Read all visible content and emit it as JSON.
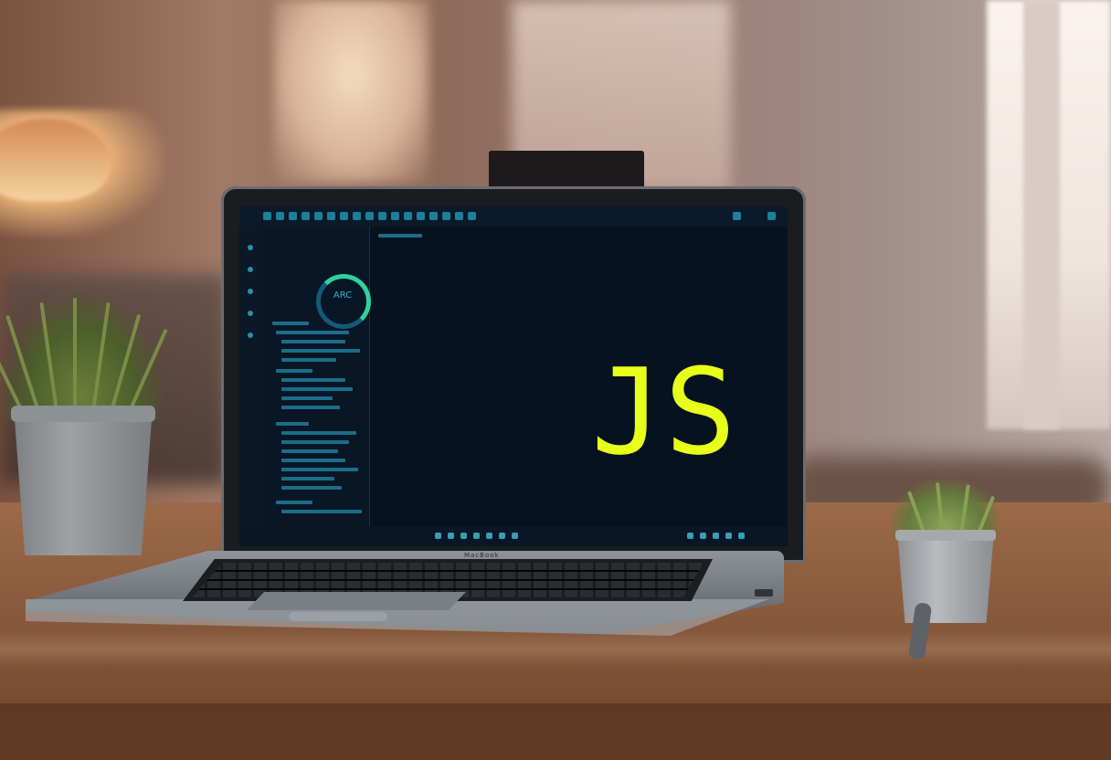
{
  "scene": {
    "screen_overlay_text": "JS",
    "editor_ring_text": "ARC",
    "laptop_brand_text": "MacBook"
  },
  "colors": {
    "js_label": "#e8ff1a",
    "editor_background": "#071220",
    "editor_accent": "#2fd29e",
    "table_wood": "#8a5a3c"
  }
}
